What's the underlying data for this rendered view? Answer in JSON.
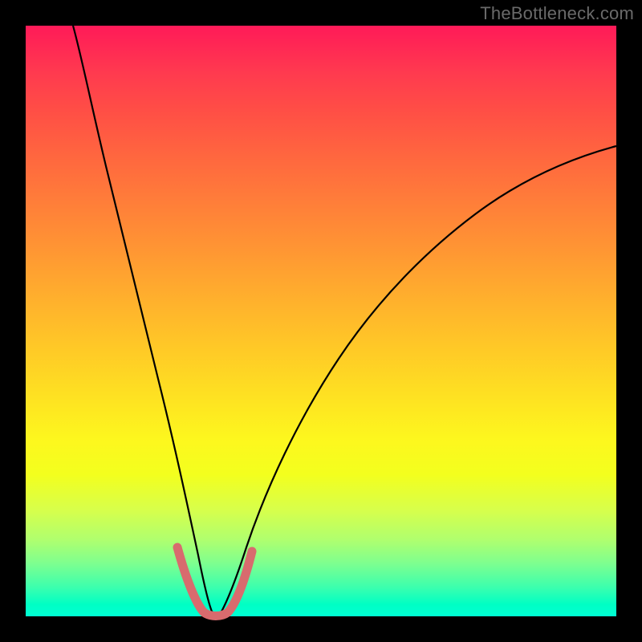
{
  "watermark": "TheBottleneck.com",
  "chart_data": {
    "type": "line",
    "title": "",
    "xlabel": "",
    "ylabel": "",
    "xlim": [
      0,
      100
    ],
    "ylim": [
      0,
      100
    ],
    "gradient_stops": [
      {
        "pct": 0,
        "color": "#ff1a58"
      },
      {
        "pct": 22,
        "color": "#ff663f"
      },
      {
        "pct": 46,
        "color": "#ffaf2d"
      },
      {
        "pct": 70,
        "color": "#fdf71e"
      },
      {
        "pct": 87,
        "color": "#b0ff6e"
      },
      {
        "pct": 100,
        "color": "#00ffd4"
      }
    ],
    "series": [
      {
        "name": "curve",
        "color": "#000000",
        "points": [
          {
            "x": 8,
            "y": 100
          },
          {
            "x": 10,
            "y": 90
          },
          {
            "x": 12,
            "y": 78
          },
          {
            "x": 14,
            "y": 66
          },
          {
            "x": 16,
            "y": 55
          },
          {
            "x": 18,
            "y": 44
          },
          {
            "x": 20,
            "y": 34
          },
          {
            "x": 22,
            "y": 24
          },
          {
            "x": 24,
            "y": 15
          },
          {
            "x": 26,
            "y": 8
          },
          {
            "x": 28,
            "y": 3
          },
          {
            "x": 30,
            "y": 0.5
          },
          {
            "x": 32,
            "y": 0.5
          },
          {
            "x": 34,
            "y": 3
          },
          {
            "x": 36,
            "y": 8
          },
          {
            "x": 38,
            "y": 14
          },
          {
            "x": 42,
            "y": 24
          },
          {
            "x": 48,
            "y": 37
          },
          {
            "x": 55,
            "y": 49
          },
          {
            "x": 62,
            "y": 58
          },
          {
            "x": 70,
            "y": 65
          },
          {
            "x": 78,
            "y": 70
          },
          {
            "x": 86,
            "y": 74
          },
          {
            "x": 94,
            "y": 77
          },
          {
            "x": 100,
            "y": 79
          }
        ]
      },
      {
        "name": "highlight",
        "color": "#d86b6e",
        "x_range": [
          25,
          37
        ],
        "y_range": [
          0,
          12
        ]
      }
    ]
  }
}
